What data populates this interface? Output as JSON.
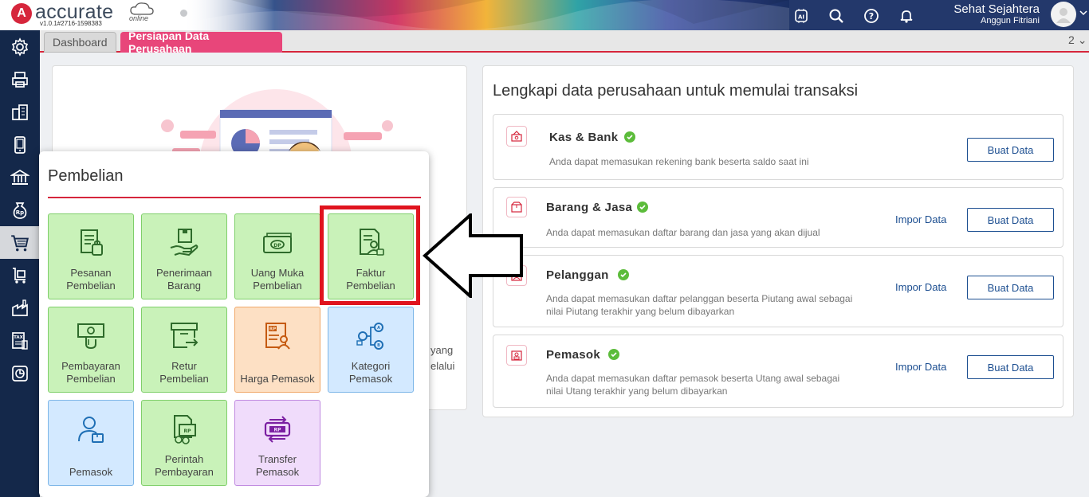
{
  "app": {
    "logo_text": "accurate",
    "logo_sub": "online",
    "version": "v1.0.1#2716-1598383",
    "user_name": "Sehat Sejahtera",
    "user_sub": "Anggun Fitriani"
  },
  "topbar_icons": [
    "ai-icon",
    "search-icon",
    "help-icon",
    "bell-icon"
  ],
  "sidebar": {
    "items": [
      {
        "icon": "gear-icon"
      },
      {
        "icon": "printer-icon"
      },
      {
        "icon": "building-icon"
      },
      {
        "icon": "mobile-icon"
      },
      {
        "icon": "bank-icon"
      },
      {
        "icon": "money-bag-icon"
      },
      {
        "icon": "cart-icon",
        "active": true
      },
      {
        "icon": "truck-cart-icon"
      },
      {
        "icon": "factory-icon"
      },
      {
        "icon": "tax-icon"
      },
      {
        "icon": "report-icon"
      }
    ]
  },
  "tabs": {
    "dashboard": "Dashboard",
    "setup": "Persiapan Data Perusahaan",
    "count": "2"
  },
  "left_panel": {
    "peek_line1": "yang",
    "peek_line2": "elalui"
  },
  "right_panel": {
    "title": "Lengkapi data perusahaan untuk memulai transaksi",
    "cards": [
      {
        "title": "Kas & Bank",
        "desc": "Anda dapat memasukan rekening bank beserta saldo saat ini",
        "button": "Buat Data"
      },
      {
        "title": "Barang & Jasa",
        "desc": "Anda dapat memasukan daftar barang dan jasa yang akan dijual",
        "import": "Impor Data",
        "button": "Buat Data"
      },
      {
        "title": "Pelanggan",
        "desc": "Anda dapat memasukan daftar pelanggan beserta Piutang awal sebagai nilai Piutang terakhir yang belum dibayarkan",
        "import": "Impor Data",
        "button": "Buat Data"
      },
      {
        "title": "Pemasok",
        "desc": "Anda dapat memasukan daftar pemasok beserta Utang awal sebagai nilai Utang terakhir yang belum dibayarkan",
        "import": "Impor Data",
        "button": "Buat Data"
      }
    ]
  },
  "popup": {
    "title": "Pembelian",
    "tiles": [
      {
        "label1": "Pesanan",
        "label2": "Pembelian"
      },
      {
        "label1": "Penerimaan",
        "label2": "Barang"
      },
      {
        "label1": "Uang Muka",
        "label2": "Pembelian"
      },
      {
        "label1": "Faktur",
        "label2": "Pembelian"
      },
      {
        "label1": "Pembayaran",
        "label2": "Pembelian"
      },
      {
        "label1": "Retur",
        "label2": "Pembelian"
      },
      {
        "label1": "Harga Pemasok",
        "label2": ""
      },
      {
        "label1": "Kategori",
        "label2": "Pemasok"
      },
      {
        "label1": "Pemasok",
        "label2": ""
      },
      {
        "label1": "Perintah",
        "label2": "Pembayaran"
      },
      {
        "label1": "Transfer",
        "label2": "Pemasok"
      }
    ]
  },
  "colors": {
    "brand": "#d6263c",
    "sidebar": "#14284a",
    "tab_active": "#e8467a",
    "link": "#1d4f91",
    "check": "#5cbc3b",
    "highlight": "#e0141e"
  }
}
